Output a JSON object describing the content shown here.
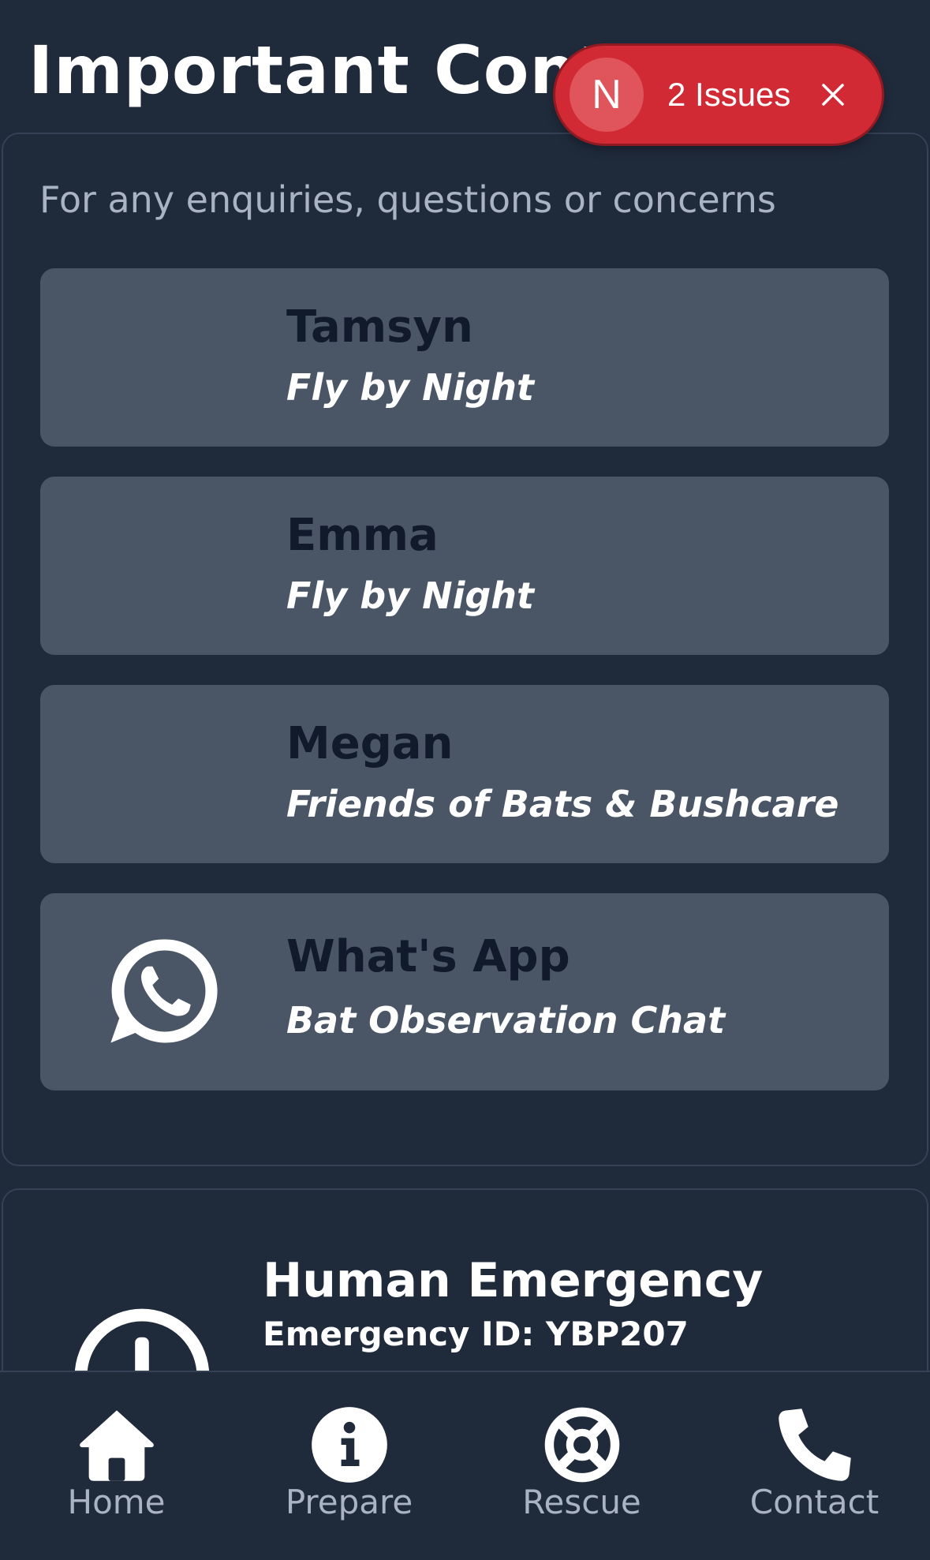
{
  "header": {
    "title": "Important Contacts"
  },
  "dev_overlay": {
    "badge_letter": "N",
    "issues_label": "2 Issues",
    "close_icon": "close-icon"
  },
  "contacts": {
    "intro": "For any enquiries, questions or concerns",
    "items": [
      {
        "name": "Tamsyn",
        "org": "Fly by Night"
      },
      {
        "name": "Emma",
        "org": "Fly by Night"
      },
      {
        "name": "Megan",
        "org": "Friends of Bats & Bushcare"
      },
      {
        "name": "What's App",
        "org": "Bat Observation Chat",
        "icon": "whatsapp-icon"
      }
    ]
  },
  "emergency": {
    "title": "Human Emergency",
    "id_line": "Emergency ID: YBP207",
    "icon": "alert-circle-icon"
  },
  "nav": {
    "items": [
      {
        "label": "Home",
        "icon": "home-icon"
      },
      {
        "label": "Prepare",
        "icon": "info-icon"
      },
      {
        "label": "Rescue",
        "icon": "lifebuoy-icon"
      },
      {
        "label": "Contact",
        "icon": "phone-icon"
      }
    ]
  },
  "colors": {
    "background": "#1f2a3b",
    "card_fill": "#4a5566",
    "issues_red": "#d12a35",
    "muted_text": "#aab3c2"
  }
}
